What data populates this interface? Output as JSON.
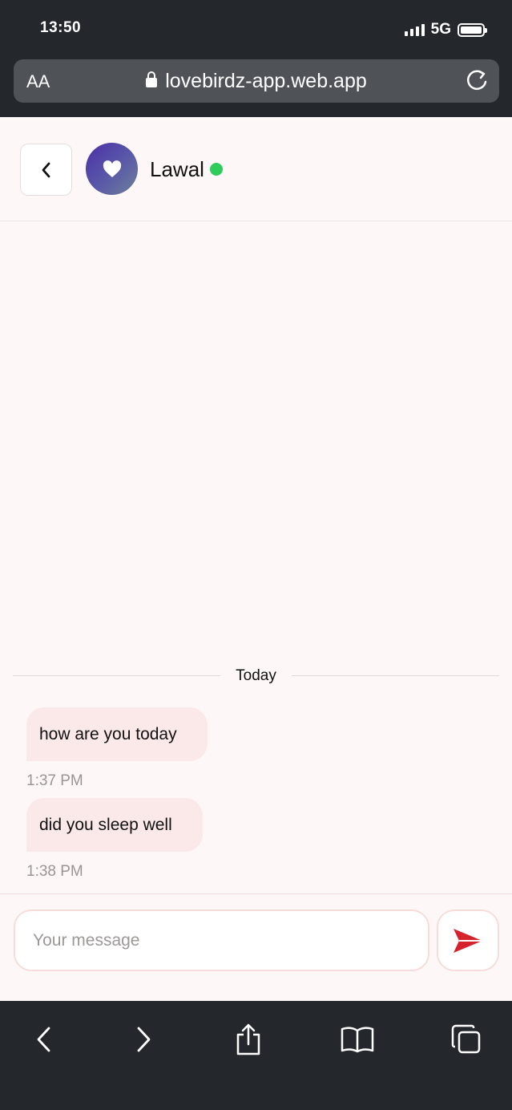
{
  "status_bar": {
    "time": "13:50",
    "network": "5G"
  },
  "browser": {
    "text_size_label": "AA",
    "url": "lovebirdz-app.web.app"
  },
  "chat": {
    "contact_name": "Lawal",
    "online": true,
    "date_divider": "Today",
    "messages": [
      {
        "text": "how are you today",
        "time": "1:37 PM"
      },
      {
        "text": "did you sleep well",
        "time": "1:38 PM"
      }
    ]
  },
  "composer": {
    "placeholder": "Your message"
  },
  "colors": {
    "accent": "#d6232b",
    "bubble": "#fbe9e9",
    "online": "#2ecc5a",
    "background": "#fdf8f7"
  },
  "icons": {
    "back": "chevron-left-icon",
    "avatar": "heart-icon",
    "send": "paper-plane-icon",
    "lock": "lock-icon",
    "reload": "reload-icon",
    "toolbar": [
      "back-arrow-icon",
      "forward-arrow-icon",
      "share-icon",
      "bookmarks-icon",
      "tabs-icon"
    ]
  }
}
